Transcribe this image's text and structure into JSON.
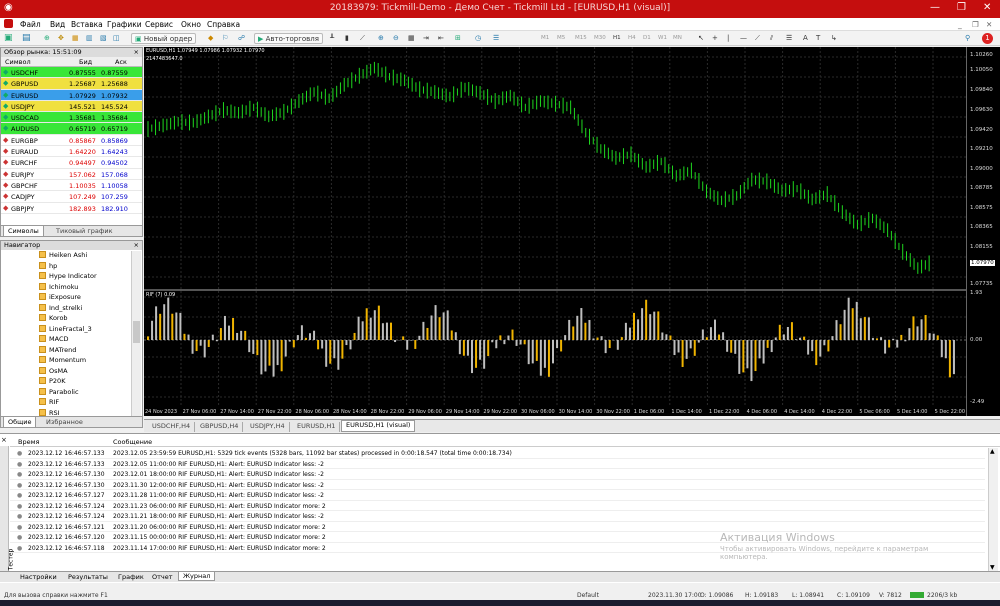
{
  "title": "20183979: Tickmill-Demo - Демо Счет - Tickmill Ltd - [EURUSD,H1 (visual)]",
  "menu": [
    "Файл",
    "Вид",
    "Вставка",
    "Графики",
    "Сервис",
    "Окно",
    "Справка"
  ],
  "toolbar": {
    "new_order": "Новый ордер",
    "autotrade": "Авто-торговля",
    "timeframes": [
      "M1",
      "M5",
      "M15",
      "M30",
      "H1",
      "H4",
      "D1",
      "W1",
      "MN"
    ]
  },
  "market_watch": {
    "header": "Обзор рынка: 15:51:09",
    "col_symbol": "Символ",
    "col_bid": "Бид",
    "col_ask": "Аск",
    "rows": [
      {
        "s": "USDCHF",
        "b": "0.87555",
        "a": "0.87559",
        "c": "#38e638"
      },
      {
        "s": "GBPUSD",
        "b": "1.25687",
        "a": "1.25688",
        "c": "#f0e040"
      },
      {
        "s": "EURUSD",
        "b": "1.07929",
        "a": "1.07932",
        "c": "#3a9eea"
      },
      {
        "s": "USDJPY",
        "b": "145.521",
        "a": "145.524",
        "c": "#f0e040"
      },
      {
        "s": "USDCAD",
        "b": "1.35681",
        "a": "1.35684",
        "c": "#38e638"
      },
      {
        "s": "AUDUSD",
        "b": "0.65719",
        "a": "0.65719",
        "c": "#38e638"
      },
      {
        "s": "EURGBP",
        "b": "0.85867",
        "a": "0.85869",
        "c": "#fff"
      },
      {
        "s": "EURAUD",
        "b": "1.64220",
        "a": "1.64243",
        "c": "#fff"
      },
      {
        "s": "EURCHF",
        "b": "0.94497",
        "a": "0.94502",
        "c": "#fff"
      },
      {
        "s": "EURJPY",
        "b": "157.062",
        "a": "157.068",
        "c": "#fff"
      },
      {
        "s": "GBPCHF",
        "b": "1.10035",
        "a": "1.10058",
        "c": "#fff"
      },
      {
        "s": "CADJPY",
        "b": "107.249",
        "a": "107.259",
        "c": "#fff"
      },
      {
        "s": "GBPJPY",
        "b": "182.893",
        "a": "182.910",
        "c": "#fff"
      }
    ],
    "tabs": [
      "Символы",
      "Тиковый график"
    ]
  },
  "navigator": {
    "header": "Навигатор",
    "items": [
      "Heiken Ashi",
      "hp",
      "Hype Indicator",
      "Ichimoku",
      "iExposure",
      "Ind_strelki",
      "Korob",
      "LineFractal_3",
      "MACD",
      "MATrend",
      "Momentum",
      "OsMA",
      "P20K",
      "Parabolic",
      "RIF",
      "RSI"
    ],
    "tabs": [
      "Общие",
      "Избранное"
    ]
  },
  "chart": {
    "info": "EURUSD,H1  1.07949 1.07986 1.07932 1.07970",
    "info2": "2147483647.0",
    "ind_info": "RIF (7) 0.09",
    "price_labels": [
      "1.10260",
      "1.10050",
      "1.09840",
      "1.09630",
      "1.09420",
      "1.09210",
      "1.09000",
      "1.08785",
      "1.08575",
      "1.08365",
      "1.08155",
      "1.07970",
      "1.07735"
    ],
    "ind_labels": [
      "1.93",
      "0.00",
      "-2.49"
    ],
    "time_labels": [
      "24 Nov 2023",
      "27 Nov 06:00",
      "27 Nov 14:00",
      "27 Nov 22:00",
      "28 Nov 06:00",
      "28 Nov 14:00",
      "28 Nov 22:00",
      "29 Nov 06:00",
      "29 Nov 14:00",
      "29 Nov 22:00",
      "30 Nov 06:00",
      "30 Nov 14:00",
      "30 Nov 22:00",
      "1 Dec 06:00",
      "1 Dec 14:00",
      "1 Dec 22:00",
      "4 Dec 06:00",
      "4 Dec 14:00",
      "4 Dec 22:00",
      "5 Dec 06:00",
      "5 Dec 14:00",
      "5 Dec 22:00"
    ],
    "tabs": [
      "USDCHF,H4",
      "GBPUSD,H4",
      "USDJPY,H4",
      "EURUSD,H1",
      "EURUSD,H1 (visual)"
    ]
  },
  "chart_data": {
    "type": "line",
    "title": "EURUSD,H1",
    "ylim": [
      1.07735,
      1.1026
    ],
    "series": [
      {
        "name": "EURUSD",
        "values": [
          1.0944,
          1.0948,
          1.0952,
          1.0951,
          1.0958,
          1.0965,
          1.0962,
          1.0968,
          1.0958,
          1.0963,
          1.0975,
          1.0985,
          1.0978,
          1.0993,
          1.1003,
          1.1012,
          1.1002,
          1.0998,
          1.0988,
          1.0985,
          1.098,
          1.099,
          1.0984,
          1.0975,
          1.0981,
          1.0968,
          1.0975,
          1.0972,
          1.0968,
          1.094,
          1.0922,
          1.0912,
          1.0916,
          1.0902,
          1.0908,
          1.0892,
          1.0898,
          1.0875,
          1.0865,
          1.087,
          1.0888,
          1.0886,
          1.0876,
          1.0878,
          1.0866,
          1.0872,
          1.0852,
          1.0838,
          1.0845,
          1.0832,
          1.0808,
          1.079,
          1.0797
        ]
      }
    ]
  },
  "terminal": {
    "col_time": "Время",
    "col_msg": "Сообщение",
    "rows": [
      {
        "t": "2023.12.12 16:46:57.133",
        "m": "2023.12.05 23:59:59  EURUSD,H1: 5329 tick events (5328 bars, 11092 bar states) processed in 0:00:18.547 (total time 0:00:18.734)"
      },
      {
        "t": "2023.12.12 16:46:57.133",
        "m": "2023.12.05 11:00:00  RIF EURUSD,H1: Alert: EURUSD Indicator less: -2"
      },
      {
        "t": "2023.12.12 16:46:57.130",
        "m": "2023.12.01 18:00:00  RIF EURUSD,H1: Alert: EURUSD Indicator less: -2"
      },
      {
        "t": "2023.12.12 16:46:57.130",
        "m": "2023.11.30 12:00:00  RIF EURUSD,H1: Alert: EURUSD Indicator less: -2"
      },
      {
        "t": "2023.12.12 16:46:57.127",
        "m": "2023.11.28 11:00:00  RIF EURUSD,H1: Alert: EURUSD Indicator less: -2"
      },
      {
        "t": "2023.12.12 16:46:57.124",
        "m": "2023.11.23 06:00:00  RIF EURUSD,H1: Alert: EURUSD Indicator more: 2"
      },
      {
        "t": "2023.12.12 16:46:57.124",
        "m": "2023.11.21 18:00:00  RIF EURUSD,H1: Alert: EURUSD Indicator less: -2"
      },
      {
        "t": "2023.12.12 16:46:57.121",
        "m": "2023.11.20 06:00:00  RIF EURUSD,H1: Alert: EURUSD Indicator more: 2"
      },
      {
        "t": "2023.12.12 16:46:57.120",
        "m": "2023.11.15 00:00:00  RIF EURUSD,H1: Alert: EURUSD Indicator more: 2"
      },
      {
        "t": "2023.12.12 16:46:57.118",
        "m": "2023.11.14 17:00:00  RIF EURUSD,H1: Alert: EURUSD Indicator more: 2"
      }
    ],
    "tabs": [
      "Настройки",
      "Результаты",
      "График",
      "Отчет",
      "Журнал"
    ],
    "side": "Тестер"
  },
  "status": {
    "help": "Для вызова справки нажмите F1",
    "profile": "Default",
    "time": "2023.11.30 17:00",
    "o": "O: 1.09086",
    "h": "H: 1.09183",
    "l": "L: 1.08941",
    "c": "C: 1.09109",
    "v": "V: 7812",
    "kb": "2206/3 kb"
  },
  "watermark": {
    "line1": "Активация Windows",
    "line2": "Чтобы активировать Windows, перейдите к параметрам компьютера."
  }
}
